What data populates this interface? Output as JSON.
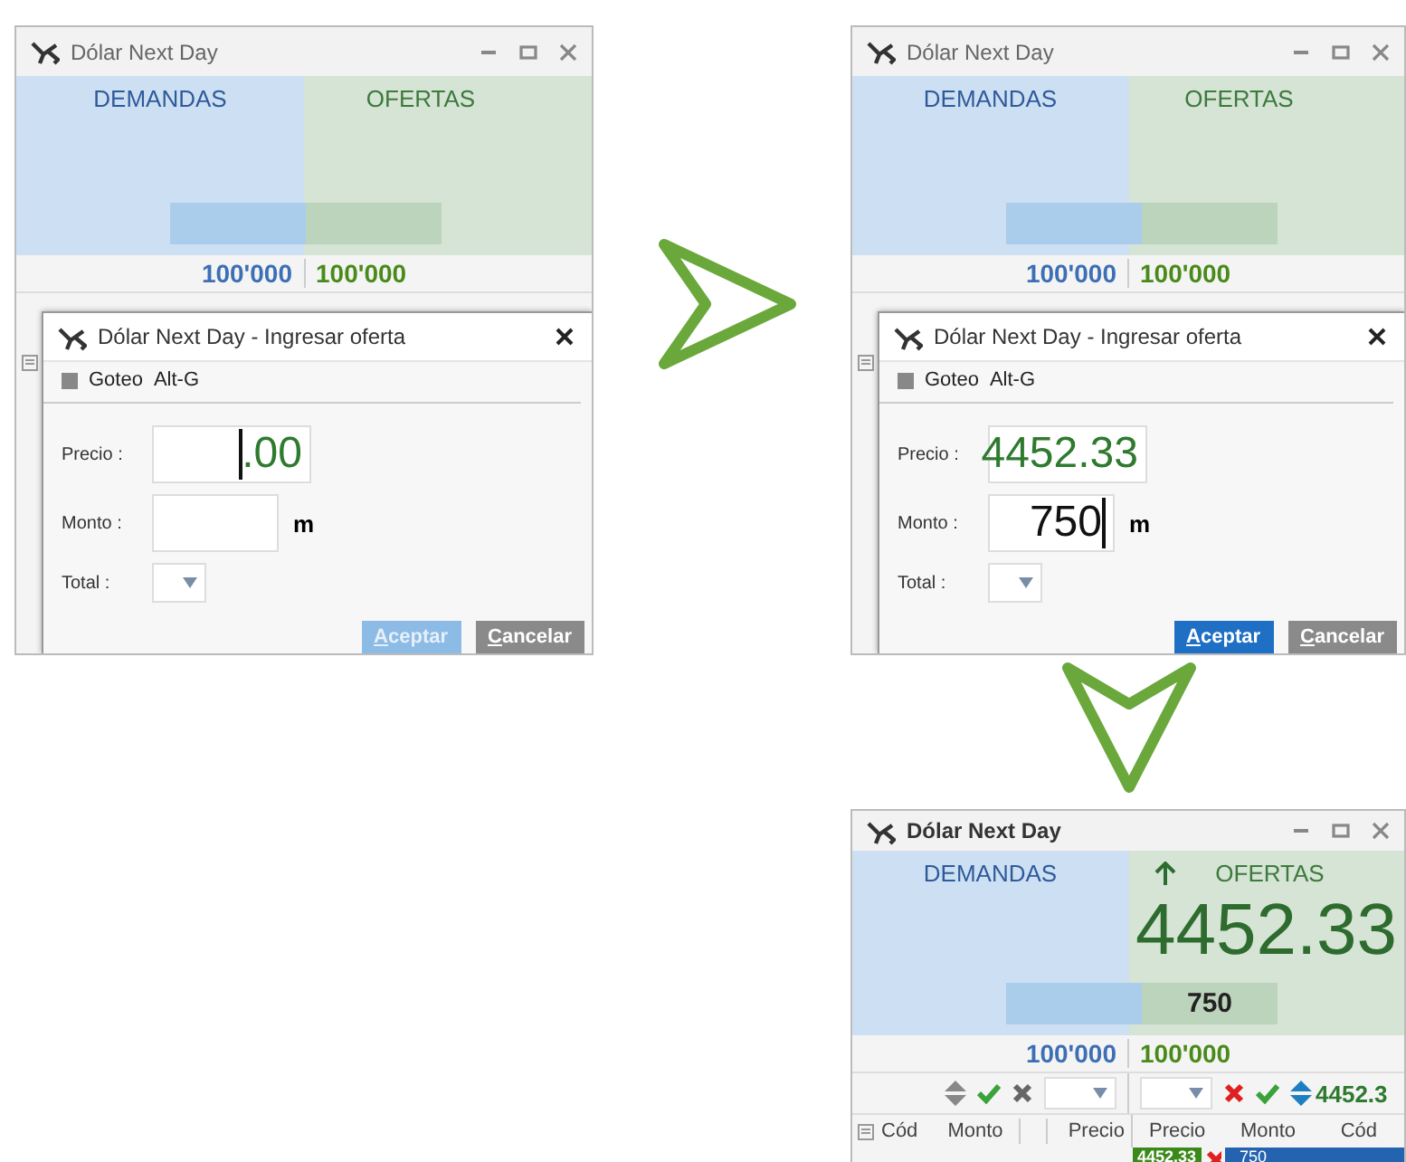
{
  "panels": [
    {
      "kind": "entry",
      "window": {
        "title": "Dólar Next Day"
      },
      "market": {
        "demand_label": "DEMANDAS",
        "offer_label": "OFERTAS",
        "demand_total": "100'000",
        "offer_total": "100'000"
      },
      "dialog": {
        "title": "Dólar Next Day - Ingresar oferta",
        "goteo": {
          "label": "Goteo",
          "checked": false,
          "shortcut": "Alt-G"
        },
        "fields": [
          {
            "label": "Precio :",
            "value": ".00",
            "kind": "price",
            "cursor_before": true
          },
          {
            "label": "Monto :",
            "kind": "amount",
            "unit": "m"
          }
        ],
        "total_label": "Total :",
        "buttons": [
          {
            "label": "Aceptar",
            "kind": "primary",
            "disabled": true
          },
          {
            "label": "Cancelar",
            "kind": "secondary",
            "disabled": false
          }
        ]
      }
    },
    {
      "kind": "entry",
      "window": {
        "title": "Dólar Next Day"
      },
      "market": {
        "demand_label": "DEMANDAS",
        "offer_label": "OFERTAS",
        "demand_total": "100'000",
        "offer_total": "100'000"
      },
      "dialog": {
        "title": "Dólar Next Day - Ingresar oferta",
        "goteo": {
          "label": "Goteo",
          "checked": false,
          "shortcut": "Alt-G"
        },
        "fields": [
          {
            "label": "Precio :",
            "value": "4452.33",
            "kind": "price"
          },
          {
            "label": "Monto :",
            "value": "750",
            "kind": "amount",
            "unit": "m",
            "cursor_after": true
          }
        ],
        "total_label": "Total :",
        "buttons": [
          {
            "label": "Aceptar",
            "kind": "primary",
            "disabled": false
          },
          {
            "label": "Cancelar",
            "kind": "secondary",
            "disabled": false
          }
        ]
      }
    },
    {
      "kind": "book",
      "window": {
        "title": "Dólar Next Day"
      },
      "market": {
        "demand_label": "DEMANDAS",
        "offer_label": "OFERTAS",
        "demand_total": "100'000",
        "offer_total": "100'000",
        "offer_price": "4452.33",
        "offer_amount": "750"
      },
      "toolbar": {
        "offer_price": "4452.3"
      },
      "columns_left": [
        "Cód",
        "Monto",
        "Precio"
      ],
      "columns_right": [
        "Precio",
        "Monto",
        "Cód"
      ],
      "rows": [
        {
          "price": "4452.33",
          "amount": "750"
        }
      ]
    }
  ]
}
